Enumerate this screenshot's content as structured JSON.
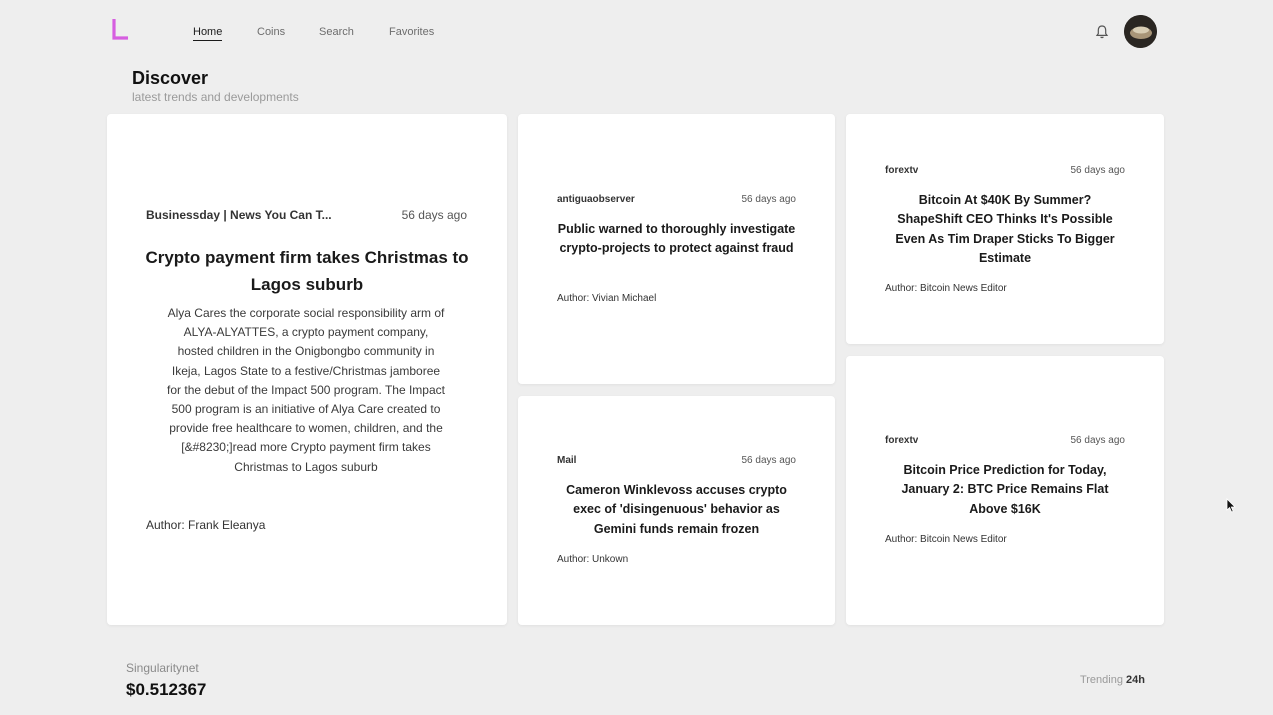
{
  "nav": {
    "items": [
      {
        "label": "Home",
        "active": true
      },
      {
        "label": "Coins",
        "active": false
      },
      {
        "label": "Search",
        "active": false
      },
      {
        "label": "Favorites",
        "active": false
      }
    ],
    "logo_color": "#d65ee0",
    "icons": [
      "bell-icon",
      "avatar"
    ]
  },
  "header": {
    "title": "Discover",
    "subtitle": "latest trends and developments"
  },
  "cards": [
    {
      "source": "Businessday | News You Can T...",
      "time": "56 days ago",
      "title": "Crypto payment firm takes Christmas to Lagos suburb",
      "excerpt": "Alya Cares the corporate social responsibility arm of ALYA-ALYATTES, a crypto payment company, hosted children in the Onigbongbo community in Ikeja, Lagos State to a festive/Christmas jamboree for the debut of the Impact 500 program. The Impact 500 program is an initiative of Alya Care created to provide free healthcare to women, children, and the [&#8230;]read more Crypto payment firm takes Christmas to Lagos suburb",
      "author": "Author: Frank Eleanya"
    },
    {
      "source": "antiguaobserver",
      "time": "56 days ago",
      "title": "Public warned to thoroughly investigate crypto-projects to protect against fraud",
      "author": "Author: Vivian Michael"
    },
    {
      "source": "forextv",
      "time": "56 days ago",
      "title": "Bitcoin At $40K By Summer? ShapeShift CEO Thinks It's Possible Even As Tim Draper Sticks To Bigger Estimate",
      "author": "Author: Bitcoin News Editor"
    },
    {
      "source": "Mail",
      "time": "56 days ago",
      "title": "Cameron Winklevoss accuses crypto exec of 'disingenuous' behavior as Gemini funds remain frozen",
      "author": "Author: Unkown"
    },
    {
      "source": "forextv",
      "time": "56 days ago",
      "title": "Bitcoin Price Prediction for Today, January 2: BTC Price Remains Flat Above $16K",
      "author": "Author: Bitcoin News Editor"
    }
  ],
  "ticker": {
    "name": "Singularitynet",
    "price": "$0.512367"
  },
  "trending": {
    "label": "Trending",
    "period": "24h"
  }
}
